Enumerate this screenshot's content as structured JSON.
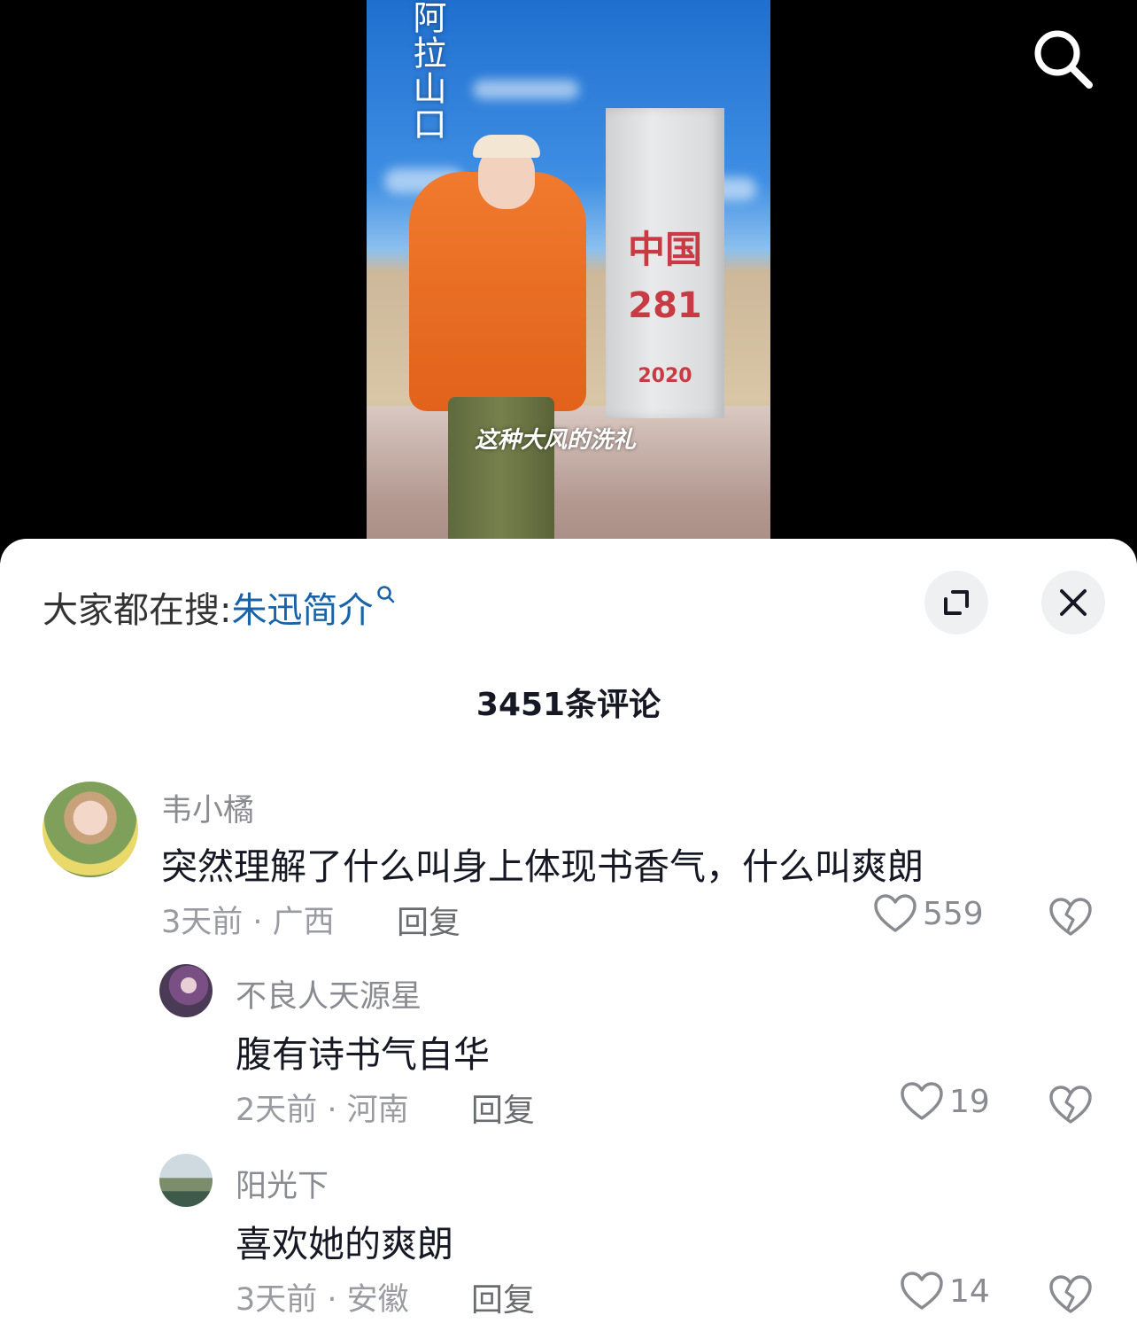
{
  "video": {
    "vertical_text": "阿拉山口",
    "stone_line1": "中国",
    "stone_line2": "281",
    "stone_line3": "2020",
    "caption": "这种大风的洗礼"
  },
  "sheet": {
    "trending_prefix": "大家都在搜:",
    "trending_keyword": "朱迅简介",
    "comment_count_title": "3451条评论"
  },
  "comments": [
    {
      "username": "韦小橘",
      "text": "突然理解了什么叫身上体现书香气，什么叫爽朗",
      "meta": "3天前 · 广西",
      "reply": "回复",
      "likes": "559"
    },
    {
      "username": "不良人天源星",
      "text": "腹有诗书气自华",
      "meta": "2天前 · 河南",
      "reply": "回复",
      "likes": "19"
    },
    {
      "username": "阳光下",
      "text": "喜欢她的爽朗",
      "meta": "3天前 · 安徽",
      "reply": "回复",
      "likes": "14"
    }
  ],
  "icons": {
    "search": "search-icon",
    "expand": "expand-icon",
    "close": "close-icon",
    "like": "heart-icon",
    "dislike": "broken-heart-icon"
  }
}
